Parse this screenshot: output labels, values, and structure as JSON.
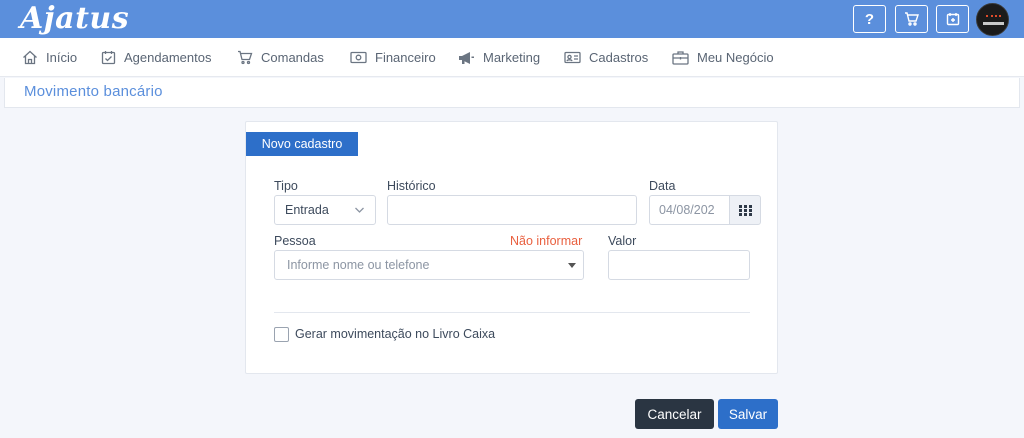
{
  "brand": {
    "logo_text": "Ajatus"
  },
  "topbar": {
    "help_label": "?",
    "icons": [
      "help-icon",
      "cart-icon",
      "calendar-add-icon"
    ],
    "accent": "#5b8fdc"
  },
  "nav": {
    "items": [
      {
        "label": "Início",
        "icon": "home-icon"
      },
      {
        "label": "Agendamentos",
        "icon": "calendar-check-icon"
      },
      {
        "label": "Comandas",
        "icon": "cart-icon"
      },
      {
        "label": "Financeiro",
        "icon": "money-icon"
      },
      {
        "label": "Marketing",
        "icon": "megaphone-icon"
      },
      {
        "label": "Cadastros",
        "icon": "id-card-icon"
      },
      {
        "label": "Meu Negócio",
        "icon": "briefcase-icon"
      }
    ]
  },
  "page": {
    "title": "Movimento bancário"
  },
  "form": {
    "tab_label": "Novo cadastro",
    "tipo": {
      "label": "Tipo",
      "value": "Entrada"
    },
    "historico": {
      "label": "Histórico",
      "value": ""
    },
    "data": {
      "label": "Data",
      "value": "04/08/202"
    },
    "pessoa": {
      "label": "Pessoa",
      "not_informed_label": "Não informar",
      "placeholder": "Informe nome ou telefone"
    },
    "valor": {
      "label": "Valor",
      "value": ""
    },
    "livro_caixa": {
      "label": "Gerar movimentação no Livro Caixa",
      "checked": false
    }
  },
  "actions": {
    "cancel_label": "Cancelar",
    "save_label": "Salvar"
  },
  "colors": {
    "primary": "#2d6fc9",
    "dark": "#2a3542",
    "warn": "#e9603f"
  }
}
